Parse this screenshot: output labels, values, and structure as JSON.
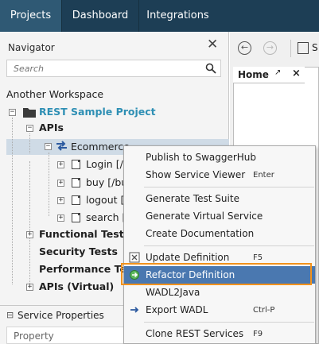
{
  "top_tabs": [
    {
      "label": "Projects",
      "active": true
    },
    {
      "label": "Dashboard",
      "active": false
    },
    {
      "label": "Integrations",
      "active": false
    }
  ],
  "navigator": {
    "title": "Navigator",
    "search_placeholder": "Search",
    "workspace": "Another Workspace",
    "project": "REST Sample Project",
    "apis_label": "APIs",
    "service_label": "Ecommerce",
    "resources": [
      "Login [/",
      "buy [/bu",
      "logout [",
      "search ["
    ],
    "folders": [
      "Functional Tests",
      "Security Tests",
      "Performance Test",
      "APIs (Virtual)"
    ]
  },
  "service_properties": {
    "title": "Service Properties",
    "column_property": "Property"
  },
  "right_panel": {
    "save_label": "S",
    "home_tab": "Home"
  },
  "context_menu": {
    "items": [
      {
        "label": "Publish to SwaggerHub",
        "shortcut": ""
      },
      {
        "label": "Show Service Viewer",
        "shortcut": "Enter"
      },
      {
        "label": "Generate Test Suite",
        "shortcut": ""
      },
      {
        "label": "Generate Virtual Service",
        "shortcut": ""
      },
      {
        "label": "Create Documentation",
        "shortcut": ""
      },
      {
        "label": "Update Definition",
        "shortcut": "F5"
      },
      {
        "label": "Refactor Definition",
        "shortcut": "",
        "highlighted": true
      },
      {
        "label": "WADL2Java",
        "shortcut": ""
      },
      {
        "label": "Export WADL",
        "shortcut": "Ctrl-P"
      },
      {
        "label": "Clone REST Services",
        "shortcut": "F9"
      }
    ]
  },
  "colors": {
    "topbar": "#1d3e55",
    "active_tab": "#2f5974",
    "project_text": "#2e8fb4",
    "menu_highlight": "#4a78b0",
    "callout_frame": "#f2921c"
  }
}
